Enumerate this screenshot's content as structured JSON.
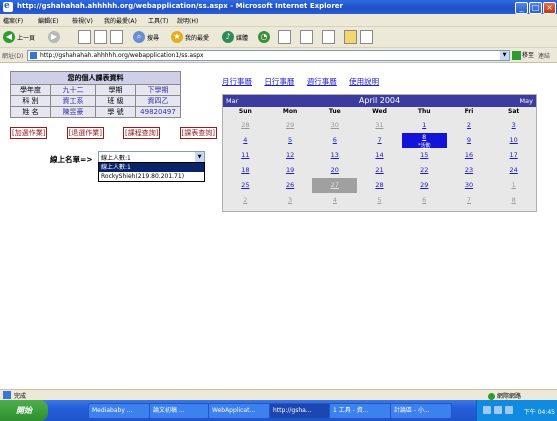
{
  "window": {
    "title": "http://gshahahah.ahhhhh.org/webapplication/ss.aspx - Microsoft Internet Explorer",
    "controls": [
      "_",
      "□",
      "×"
    ]
  },
  "menu": [
    "檔案(F)",
    "編輯(E)",
    "檢視(V)",
    "我的最愛(A)",
    "工具(T)",
    "說明(H)"
  ],
  "toolbar": {
    "back": "上一頁",
    "search": "搜尋",
    "favorites": "我的最愛",
    "media": "媒體"
  },
  "address": {
    "label": "網址(D)",
    "url": "http://gshahahah.ahhhhh.org/webapplication1/ss.aspx",
    "go": "移至",
    "links": "連結"
  },
  "profile": {
    "title": "您的個人課表資料",
    "rows": [
      [
        "學年度",
        "九十二",
        "學期",
        "下學期"
      ],
      [
        "科 別",
        "資工系",
        "班 級",
        "資四乙"
      ],
      [
        "姓 名",
        "陳昱豪",
        "學 號",
        "49820497"
      ]
    ],
    "buttons": [
      "[加選作業]",
      "[退選作業]",
      "[課程查詢]",
      "[課表查詢]"
    ]
  },
  "online": {
    "label": "線上名單=>",
    "selected": "線上人數:1",
    "options": [
      "線上人數:1",
      "RockyShieh(219.80.201.71)"
    ]
  },
  "calendar_nav": [
    "月行事曆",
    "日行事曆",
    "週行事曆",
    "使用說明"
  ],
  "calendar": {
    "prev": "Mar",
    "month": "April 2004",
    "next": "May",
    "days": [
      "Sun",
      "Mon",
      "Tue",
      "Wed",
      "Thu",
      "Fri",
      "Sat"
    ],
    "weeks": [
      [
        "28",
        "29",
        "30",
        "31",
        "1",
        "2",
        "3"
      ],
      [
        "4",
        "5",
        "6",
        "7",
        "8",
        "9",
        "10"
      ],
      [
        "11",
        "12",
        "13",
        "14",
        "15",
        "16",
        "17"
      ],
      [
        "18",
        "19",
        "20",
        "21",
        "22",
        "23",
        "24"
      ],
      [
        "25",
        "26",
        "27",
        "28",
        "29",
        "30",
        "1"
      ],
      [
        "2",
        "3",
        "4",
        "5",
        "6",
        "7",
        "8"
      ]
    ],
    "today_event": "*活動"
  },
  "status": {
    "text": "完成",
    "zone": "網際網路"
  },
  "taskbar": {
    "start": "開始",
    "tasks": [
      "Mediababy ...",
      "論文初稿 ...",
      "WebApplicat...",
      "http://gsha...",
      "1 工具 - 資...",
      "計論區 - 小..."
    ],
    "time": "下午 04:45"
  }
}
